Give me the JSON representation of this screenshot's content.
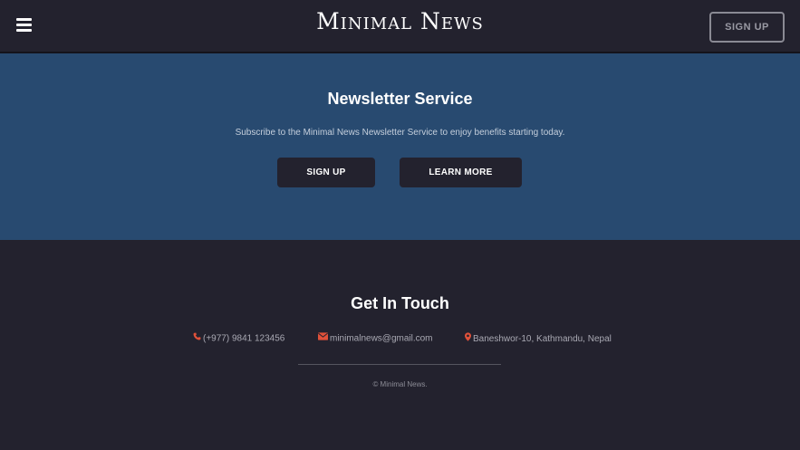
{
  "header": {
    "brand": "Minimal News",
    "signup_label": "SIGN UP"
  },
  "newsletter": {
    "title": "Newsletter Service",
    "description": "Subscribe to the Minimal News Newsletter Service to enjoy benefits starting today.",
    "signup_label": "SIGN UP",
    "learn_more_label": "LEARN MORE"
  },
  "contact": {
    "title": "Get In Touch",
    "phone": "(+977) 9841 123456",
    "email": "minimalnews@gmail.com",
    "address": "Baneshwor-10, Kathmandu, Nepal",
    "copyright": "© Minimal News."
  },
  "colors": {
    "navbar_bg": "#23222e",
    "newsletter_bg": "#284a70",
    "icon_accent": "#e0513a"
  },
  "icons": [
    "menu-icon",
    "phone-icon",
    "envelope-icon",
    "map-marker-icon"
  ]
}
